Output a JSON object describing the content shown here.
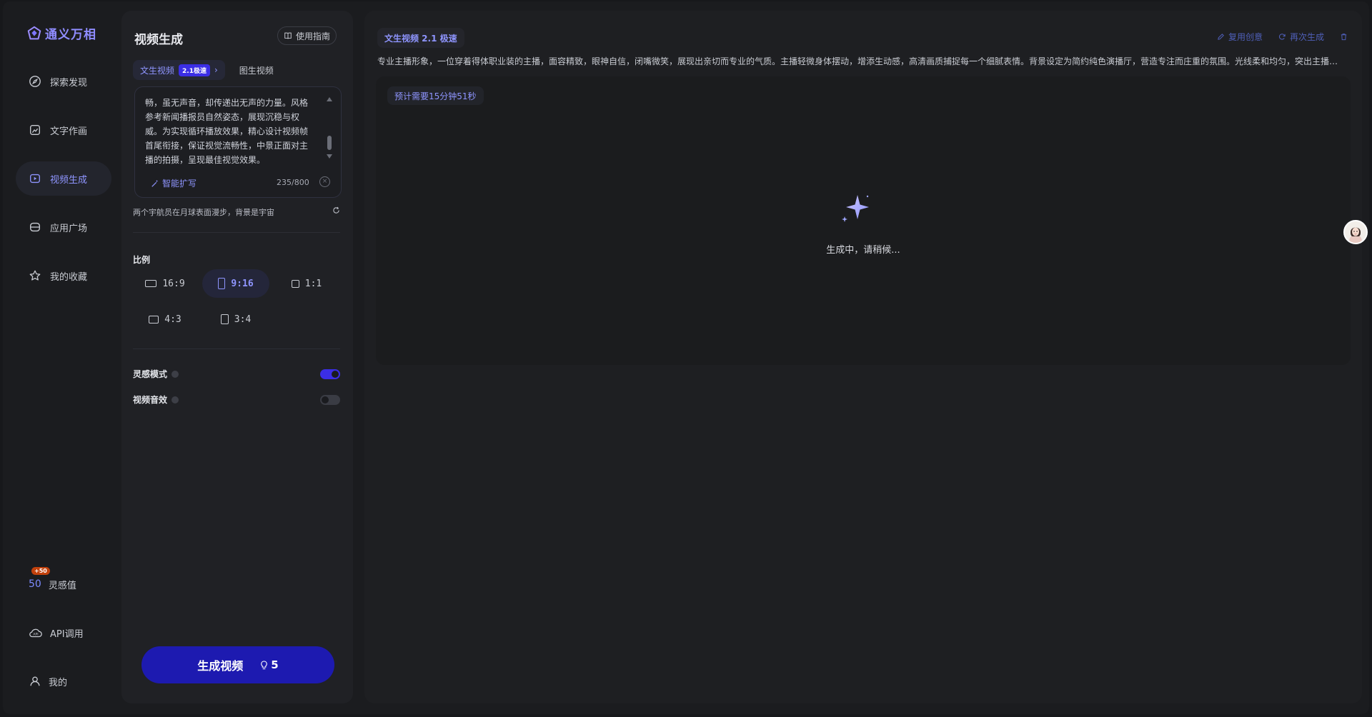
{
  "brand": {
    "name": "通义万相",
    "accent": "#8f95ff"
  },
  "nav": {
    "items": [
      {
        "label": "探索发现",
        "icon": "compass-icon"
      },
      {
        "label": "文字作画",
        "icon": "image-edit-icon"
      },
      {
        "label": "视频生成",
        "icon": "video-play-icon",
        "active": true
      },
      {
        "label": "应用广场",
        "icon": "apps-icon"
      },
      {
        "label": "我的收藏",
        "icon": "star-icon"
      }
    ],
    "inspiration": {
      "value": "50",
      "badge": "+50",
      "label": "灵感值"
    },
    "api_label": "API调用",
    "profile_label": "我的"
  },
  "panel": {
    "title": "视频生成",
    "guide_label": "使用指南",
    "tab_active": "文生视频",
    "tab_badge": "2.1极速",
    "tab_other": "图生视频",
    "prompt_text": "畅，虽无声音，却传递出无声的力量。风格参考新闻播报员自然姿态，展现沉稳与权威。为实现循环播放效果，精心设计视频帧首尾衔接，保证视觉流畅性，中景正面对主播的拍摄，呈现最佳视觉效果。",
    "expand_label": "智能扩写",
    "char_count": "235/800",
    "hint": "两个宇航员在月球表面漫步，背景是宇宙",
    "ratio_label": "比例",
    "ratios": [
      "16:9",
      "9:16",
      "1:1",
      "4:3",
      "3:4"
    ],
    "ratio_selected": "9:16",
    "inspiration_mode_label": "灵感模式",
    "inspiration_mode_on": true,
    "sound_label": "视频音效",
    "sound_on": false,
    "generate_label": "生成视频",
    "generate_cost": "5"
  },
  "main": {
    "tag": "文生视频 2.1 极速",
    "actions": [
      "复用创意",
      "再次生成"
    ],
    "prompt": "专业主播形象，一位穿着得体职业装的主播，面容精致，眼神自信，闭嘴微笑，展现出亲切而专业的气质。主播轻微身体摆动，增添生动感，高清画质捕捉每一个细腻表情。背景设定为简约纯色演播厅，营造专注而庄重的氛围。光线柔和均匀，突出主播面部细节，背景虚化，主体清晰，动作自然流畅，虽无声音，却传递出无声的力量。",
    "eta": "预计需要15分钟51秒",
    "status": "生成中，请稍候..."
  }
}
